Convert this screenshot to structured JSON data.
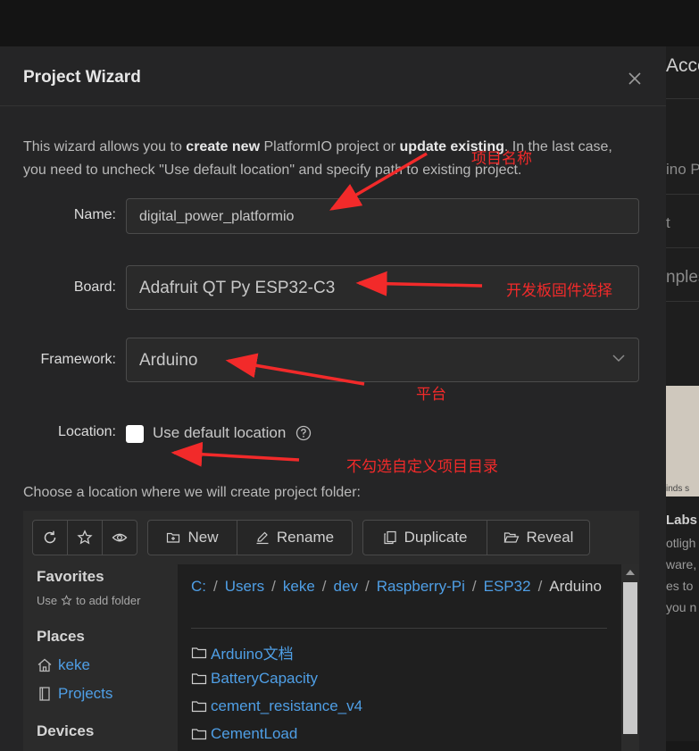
{
  "background": {
    "peek_texts": [
      "Acce",
      "ino P",
      "t",
      "nples",
      "Labs",
      "otligh",
      "ware,",
      "es to",
      "you n"
    ],
    "peek_small": "inds s"
  },
  "dialog": {
    "title": "Project Wizard",
    "intro_1": "This wizard allows you to ",
    "intro_bold_1": "create new",
    "intro_2": " PlatformIO project or ",
    "intro_bold_2": "update existing",
    "intro_3": ". In the last case, you need to uncheck \"Use default location\" and specify path to existing project."
  },
  "form": {
    "name_label": "Name",
    "name_value": "digital_power_platformio",
    "board_label": "Board",
    "board_value": "Adafruit QT Py ESP32-C3",
    "framework_label": "Framework",
    "framework_value": "Arduino",
    "location_label": "Location",
    "use_default_label": "Use default location",
    "use_default_checked": false
  },
  "colon": ":",
  "choose_text": "Choose a location where we will create project folder:",
  "browser": {
    "buttons": {
      "new": "New",
      "rename": "Rename",
      "duplicate": "Duplicate",
      "reveal": "Reveal"
    },
    "sidebar": {
      "favorites_title": "Favorites",
      "favorites_hint_pre": "Use",
      "favorites_hint_post": "to add folder",
      "places_title": "Places",
      "places": [
        "keke",
        "Projects"
      ],
      "devices_title": "Devices"
    },
    "breadcrumb": [
      "C:",
      "Users",
      "keke",
      "dev",
      "Raspberry-Pi",
      "ESP32"
    ],
    "breadcrumb_separator": "/",
    "current_folder": "Arduino",
    "folders": [
      "Arduino文档",
      "BatteryCapacity",
      "cement_resistance_v4",
      "CementLoad"
    ]
  },
  "annotations": {
    "name": "项目名称",
    "board": "开发板固件选择",
    "framework": "平台",
    "location": "不勾选自定义项目目录",
    "color": "#f22a2a"
  },
  "colors": {
    "dialog_bg": "#252526",
    "link": "#4f9fe6",
    "annotation": "#f22a2a"
  }
}
